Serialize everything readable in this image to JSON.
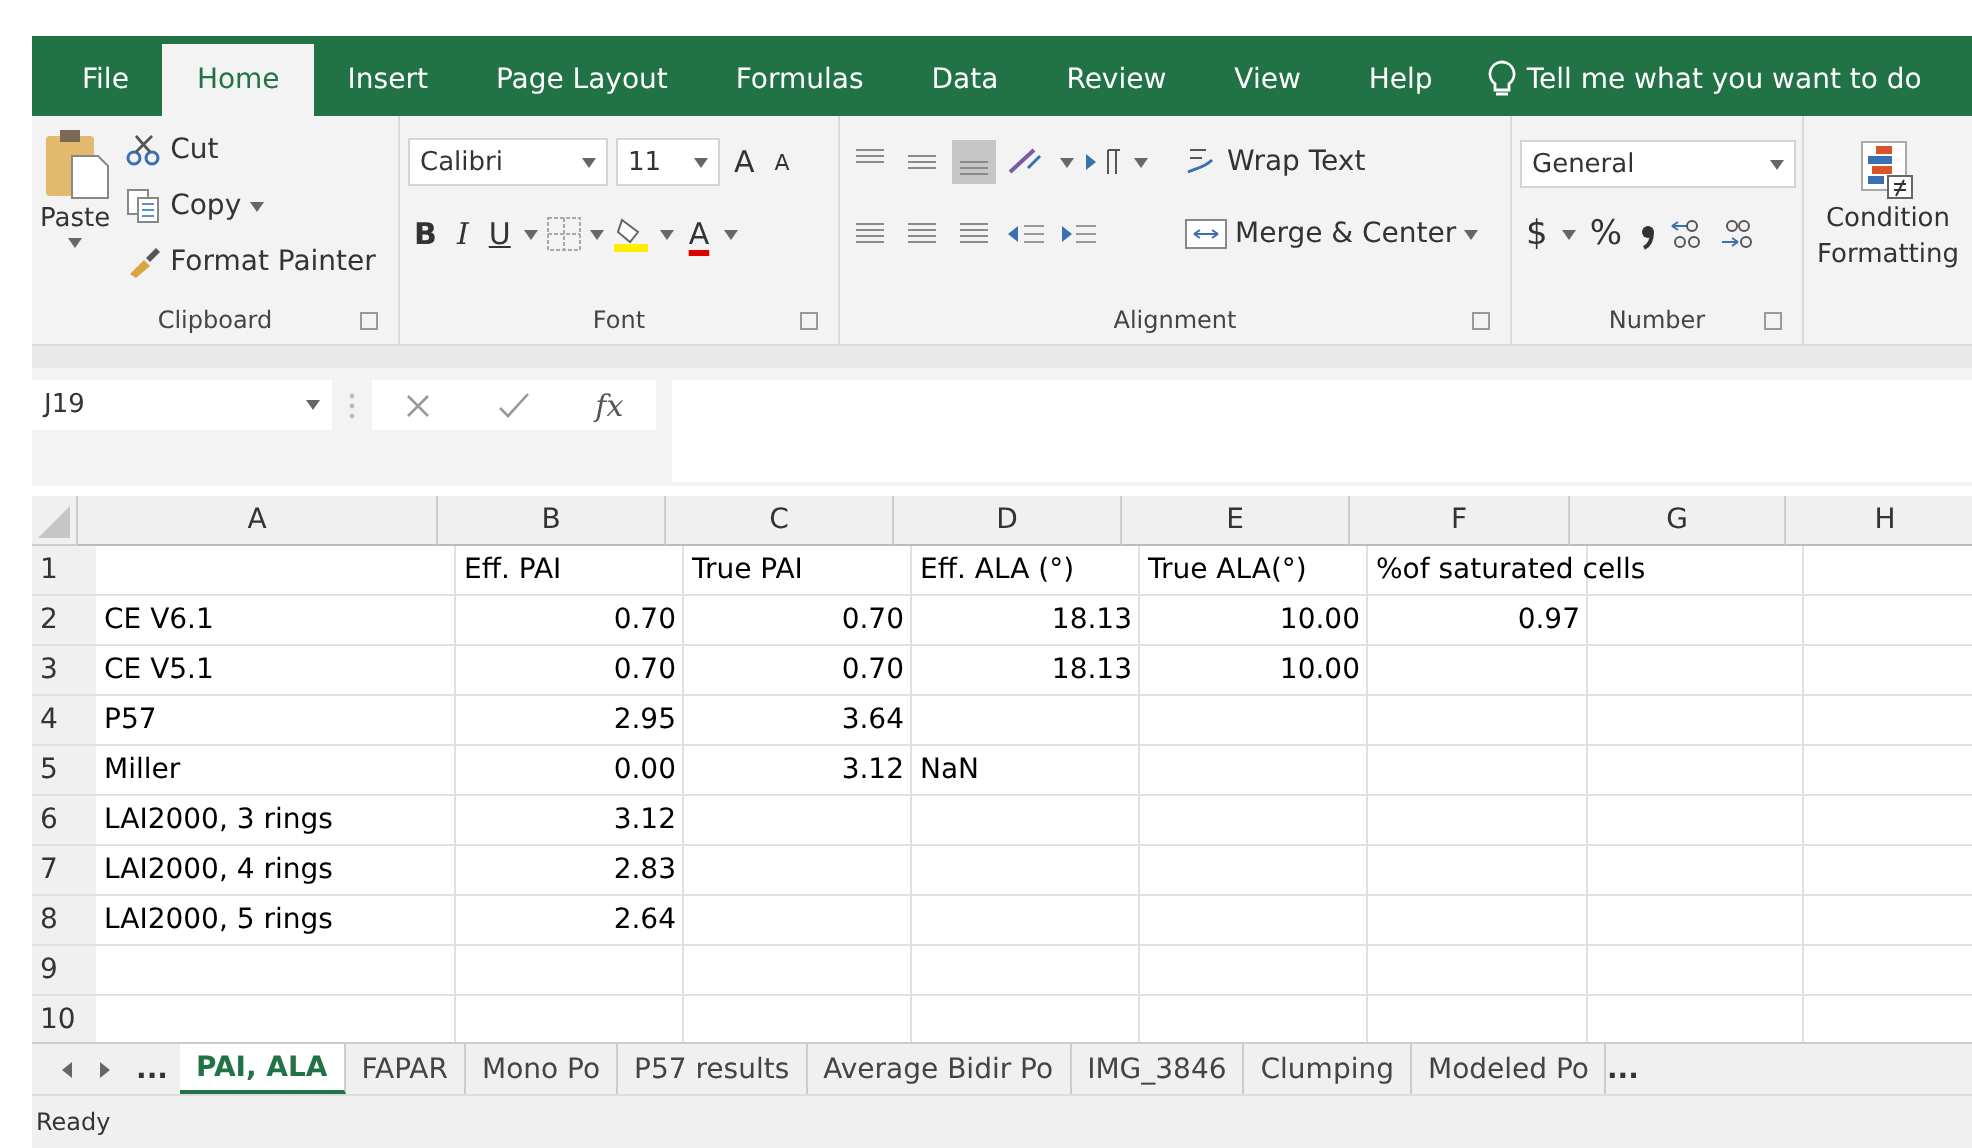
{
  "menu_tabs": [
    {
      "label": "File",
      "selected": false
    },
    {
      "label": "Home",
      "selected": true
    },
    {
      "label": "Insert",
      "selected": false
    },
    {
      "label": "Page Layout",
      "selected": false
    },
    {
      "label": "Formulas",
      "selected": false
    },
    {
      "label": "Data",
      "selected": false
    },
    {
      "label": "Review",
      "selected": false
    },
    {
      "label": "View",
      "selected": false
    },
    {
      "label": "Help",
      "selected": false
    }
  ],
  "tell_me": "Tell me what you want to do",
  "ribbon": {
    "clipboard": {
      "paste": "Paste",
      "cut": "Cut",
      "copy": "Copy",
      "format_painter": "Format Painter",
      "label": "Clipboard"
    },
    "font": {
      "font_name": "Calibri",
      "font_size": "11",
      "grow": "A",
      "shrink": "A",
      "bold": "B",
      "italic": "I",
      "underline": "U",
      "font_color": "A",
      "label": "Font"
    },
    "alignment": {
      "wrap_text": "Wrap Text",
      "merge_center": "Merge & Center",
      "label": "Alignment"
    },
    "number": {
      "format": "General",
      "currency": "$",
      "percent": "%",
      "label": "Number"
    },
    "styles": {
      "conditional_formatting": [
        "Condition",
        "Formatting"
      ]
    }
  },
  "name_box": "J19",
  "function_label": "fx",
  "columns": [
    "A",
    "B",
    "C",
    "D",
    "E",
    "F",
    "G",
    "H"
  ],
  "rows": [
    {
      "number": "1",
      "cells": [
        null,
        {
          "text": "Eff. PAI",
          "kind": "text"
        },
        {
          "text": "True PAI",
          "kind": "text"
        },
        {
          "text": "Eff. ALA (°)",
          "kind": "text"
        },
        {
          "text": "True ALA(°)",
          "kind": "text"
        },
        {
          "text": "%of saturated cells",
          "kind": "text"
        },
        null,
        null
      ]
    },
    {
      "number": "2",
      "cells": [
        {
          "text": "CE V6.1",
          "kind": "text"
        },
        {
          "text": "0.70",
          "kind": "number"
        },
        {
          "text": "0.70",
          "kind": "number"
        },
        {
          "text": "18.13",
          "kind": "number"
        },
        {
          "text": "10.00",
          "kind": "number"
        },
        {
          "text": "0.97",
          "kind": "number"
        },
        null,
        null
      ]
    },
    {
      "number": "3",
      "cells": [
        {
          "text": "CE V5.1",
          "kind": "text"
        },
        {
          "text": "0.70",
          "kind": "number"
        },
        {
          "text": "0.70",
          "kind": "number"
        },
        {
          "text": "18.13",
          "kind": "number"
        },
        {
          "text": "10.00",
          "kind": "number"
        },
        null,
        null,
        null
      ]
    },
    {
      "number": "4",
      "cells": [
        {
          "text": "P57",
          "kind": "text"
        },
        {
          "text": "2.95",
          "kind": "number"
        },
        {
          "text": "3.64",
          "kind": "number"
        },
        null,
        null,
        null,
        null,
        null
      ]
    },
    {
      "number": "5",
      "cells": [
        {
          "text": "Miller",
          "kind": "text"
        },
        {
          "text": "0.00",
          "kind": "number"
        },
        {
          "text": "3.12",
          "kind": "number"
        },
        {
          "text": "NaN",
          "kind": "text"
        },
        null,
        null,
        null,
        null
      ]
    },
    {
      "number": "6",
      "cells": [
        {
          "text": "LAI2000, 3 rings",
          "kind": "text"
        },
        {
          "text": "3.12",
          "kind": "number"
        },
        null,
        null,
        null,
        null,
        null,
        null
      ]
    },
    {
      "number": "7",
      "cells": [
        {
          "text": "LAI2000, 4 rings",
          "kind": "text"
        },
        {
          "text": "2.83",
          "kind": "number"
        },
        null,
        null,
        null,
        null,
        null,
        null
      ]
    },
    {
      "number": "8",
      "cells": [
        {
          "text": "LAI2000, 5 rings",
          "kind": "text"
        },
        {
          "text": "2.64",
          "kind": "number"
        },
        null,
        null,
        null,
        null,
        null,
        null
      ]
    },
    {
      "number": "9",
      "cells": [
        null,
        null,
        null,
        null,
        null,
        null,
        null,
        null
      ]
    },
    {
      "number": "10",
      "cells": [
        null,
        null,
        null,
        null,
        null,
        null,
        null,
        null
      ]
    }
  ],
  "sheet_nav_more": "...",
  "sheet_tabs": [
    {
      "label": "PAI, ALA",
      "selected": true
    },
    {
      "label": "FAPAR",
      "selected": false
    },
    {
      "label": "Mono Po",
      "selected": false
    },
    {
      "label": "P57 results",
      "selected": false
    },
    {
      "label": "Average Bidir Po",
      "selected": false
    },
    {
      "label": "IMG_3846",
      "selected": false
    },
    {
      "label": "Clumping",
      "selected": false
    },
    {
      "label": "Modeled Po",
      "selected": false
    }
  ],
  "sheet_tabs_more": "...",
  "status": "Ready"
}
